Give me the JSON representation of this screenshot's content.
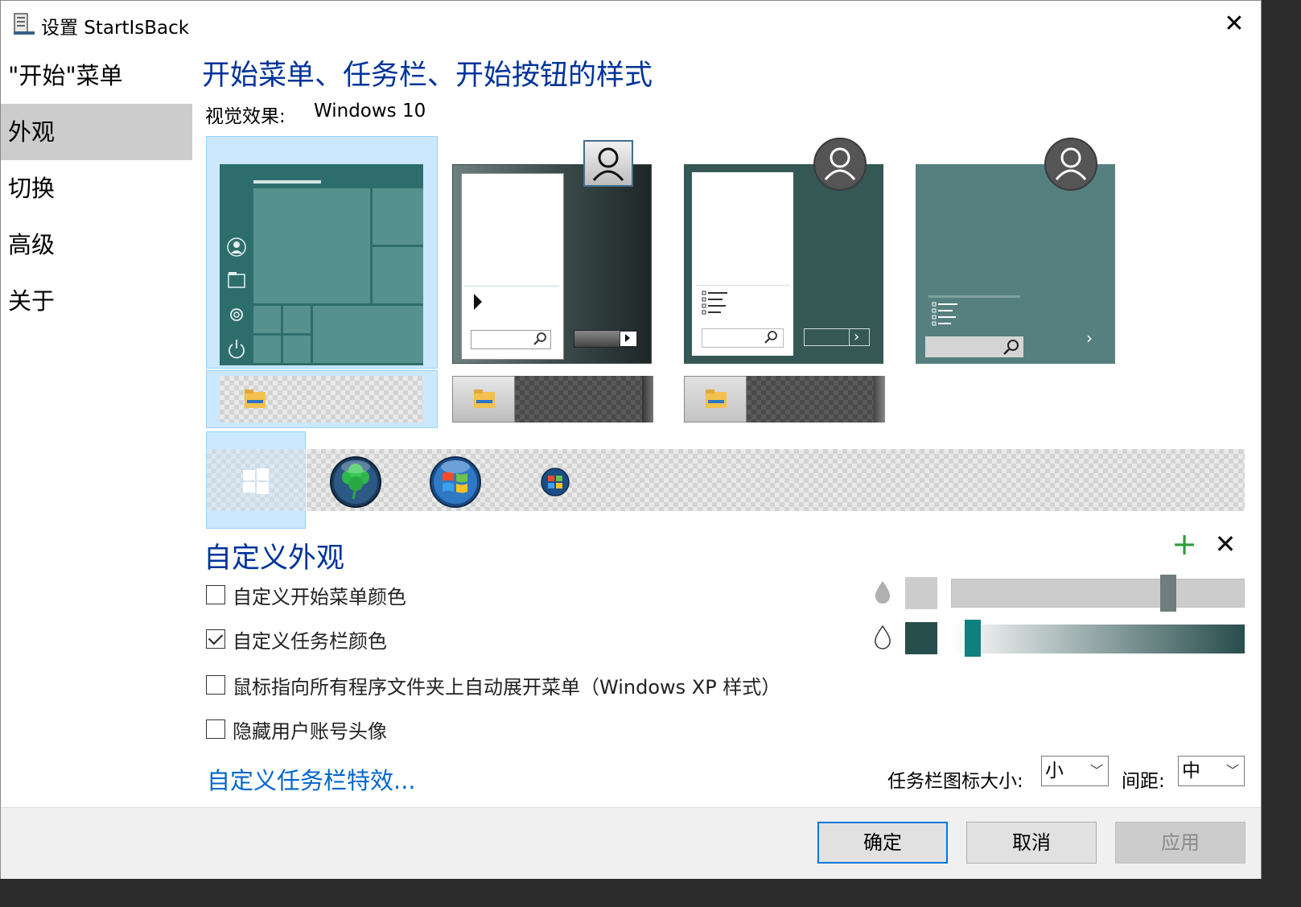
{
  "window": {
    "title": "设置 StartIsBack"
  },
  "nav": {
    "items": [
      {
        "label": "\"开始\"菜单"
      },
      {
        "label": "外观"
      },
      {
        "label": "切换"
      },
      {
        "label": "高级"
      },
      {
        "label": "关于"
      }
    ]
  },
  "main": {
    "heading": "开始菜单、任务栏、开始按钮的样式",
    "visual_effect_label": "视觉效果:",
    "visual_effect_value": "Windows 10"
  },
  "customize": {
    "heading": "自定义外观",
    "options": [
      {
        "label": "自定义开始菜单颜色",
        "checked": false
      },
      {
        "label": "自定义任务栏颜色",
        "checked": true
      },
      {
        "label": "鼠标指向所有程序文件夹上自动展开菜单（Windows XP 样式）",
        "checked": false
      },
      {
        "label": "隐藏用户账号头像",
        "checked": false
      }
    ],
    "effects_link": "自定义任务栏特效...",
    "colors": {
      "menu": "#cccccc",
      "taskbar": "#274d4c",
      "accent": "#0e8080"
    },
    "opacity_levels": [
      0.75,
      0.05
    ]
  },
  "icon_size": {
    "label": "任务栏图标大小:",
    "value": "小"
  },
  "spacing": {
    "label": "间距:",
    "value": "中"
  },
  "buttons": {
    "ok": "确定",
    "cancel": "取消",
    "apply": "应用"
  }
}
